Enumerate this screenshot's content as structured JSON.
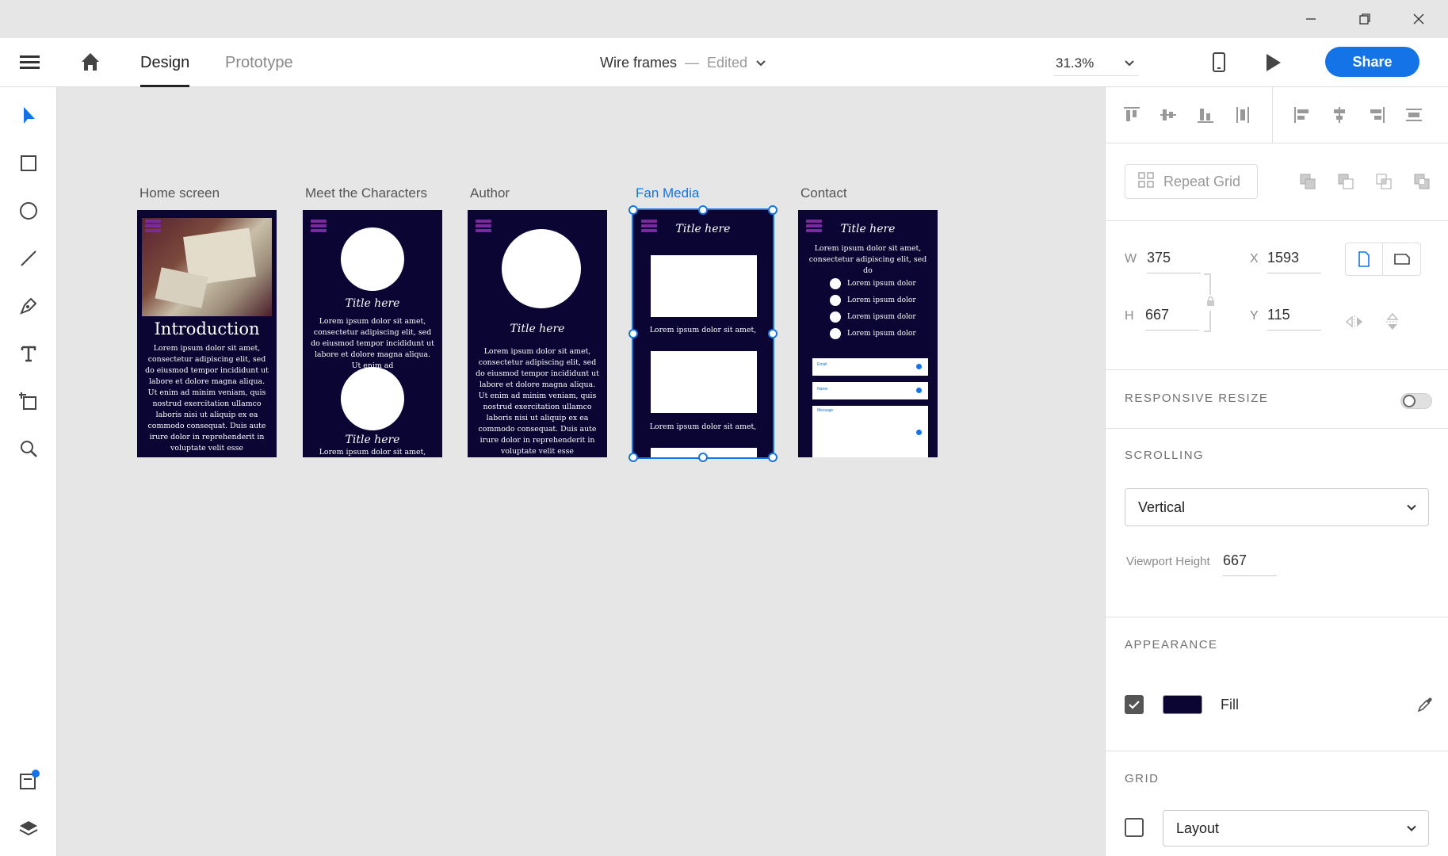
{
  "window": {
    "minimize_icon": "minimize-icon",
    "restore_icon": "restore-icon",
    "close_icon": "close-icon"
  },
  "header": {
    "tabs": [
      {
        "label": "Design",
        "active": true
      },
      {
        "label": "Prototype",
        "active": false
      }
    ],
    "doc_title": "Wire frames",
    "separator": "—",
    "doc_status": "Edited",
    "zoom": "31.3%",
    "share_label": "Share"
  },
  "artboards": [
    {
      "label": "Home screen",
      "title": "Introduction",
      "body": "Lorem ipsum dolor sit amet, consectetur adipiscing elit, sed do eiusmod tempor incididunt ut labore et dolore magna aliqua. Ut enim ad minim veniam, quis nostrud exercitation ullamco laboris nisi ut aliquip ex ea commodo consequat. Duis aute irure dolor in reprehenderit in voluptate velit esse"
    },
    {
      "label": "Meet the Characters",
      "title": "Title here",
      "body": "Lorem ipsum dolor sit amet, consectetur adipiscing elit, sed do eiusmod tempor incididunt ut labore et dolore magna aliqua. Ut enim ad",
      "title2": "Title here",
      "body2": "Lorem ipsum dolor sit amet,"
    },
    {
      "label": "Author",
      "title": "Title here",
      "body": "Lorem ipsum dolor sit amet, consectetur adipiscing elit, sed do eiusmod tempor incididunt ut labore et dolore magna aliqua. Ut enim ad minim veniam, quis nostrud exercitation ullamco laboris nisi ut aliquip ex ea commodo consequat. Duis aute irure dolor in reprehenderit in voluptate velit esse"
    },
    {
      "label": "Fan Media",
      "title": "Title here",
      "caption1": "Lorem ipsum dolor sit amet,",
      "caption2": "Lorem ipsum dolor sit amet,",
      "selected": true
    },
    {
      "label": "Contact",
      "title": "Title here",
      "body": "Lorem ipsum dolor sit amet, consectetur adipiscing elit, sed do",
      "list": [
        "Lorem ipsum dolor",
        "Lorem ipsum dolor",
        "Lorem ipsum dolor",
        "Lorem ipsum dolor"
      ],
      "fields": [
        "Email",
        "Name",
        "Message"
      ]
    }
  ],
  "panel": {
    "repeat_grid": "Repeat Grid",
    "w_label": "W",
    "w_value": "375",
    "h_label": "H",
    "h_value": "667",
    "x_label": "X",
    "x_value": "1593",
    "y_label": "Y",
    "y_value": "115",
    "responsive_resize": "RESPONSIVE RESIZE",
    "scrolling": "SCROLLING",
    "scroll_value": "Vertical",
    "viewport_label": "Viewport Height",
    "viewport_value": "667",
    "appearance": "APPEARANCE",
    "fill_label": "Fill",
    "fill_color": "#0b0533",
    "grid": "GRID",
    "grid_value": "Layout"
  },
  "colors": {
    "accent": "#1473e6",
    "artboard_bg": "#0b0533",
    "hamburger": "#7a2a9c"
  }
}
